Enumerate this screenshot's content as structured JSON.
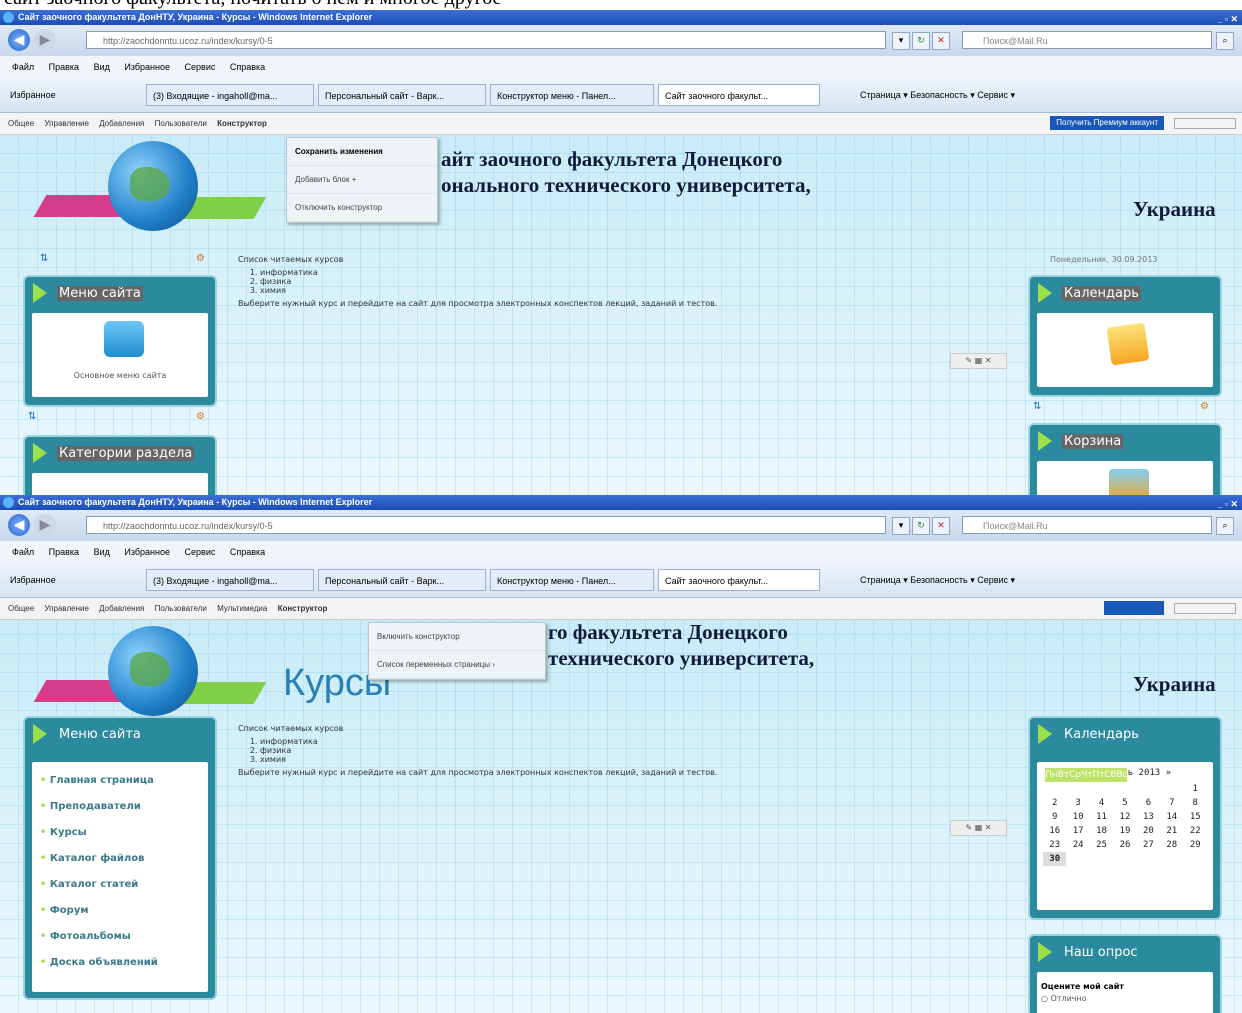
{
  "shot1": {
    "window_title": "Сайт заочного факультета ДонНТУ, Украина - Курсы - Windows Internet Explorer",
    "url": "http://zaochdonntu.ucoz.ru/index/kursy/0-5",
    "search_placeholder": "Поиск@Mail.Ru",
    "menu": [
      "Файл",
      "Правка",
      "Вид",
      "Избранное",
      "Сервис",
      "Справка"
    ],
    "favorites": "Избранное",
    "tabs": [
      "(3) Входящие - ingaholl@ma...",
      "Персональный сайт - Варк...",
      "Конструктор меню - Панел...",
      "Сайт заочного факульт..."
    ],
    "ie_right": "Страница ▾   Безопасность ▾   Сервис ▾",
    "ucoz_menu": [
      "Общее",
      "Управление",
      "Добавления",
      "Пользователи"
    ],
    "ucoz_active": "Конструктор",
    "premium": "Получить Премиум аккаунт",
    "dropdown": [
      "Сохранить изменения",
      "Добавить блок +",
      "Отключить конструктор"
    ],
    "site_title_1": "айт заочного факультета Донецкого",
    "site_title_2": "онального технического университета,",
    "country": "Украина",
    "date_fragment": "Понедельник, 30.09.2013",
    "blocks": {
      "menu": {
        "title": "Меню сайта",
        "caption": "Основное меню сайта"
      },
      "categories": {
        "title": "Категории раздела"
      },
      "calendar": {
        "title": "Календарь"
      },
      "cart": {
        "title": "Корзина"
      }
    },
    "content": {
      "heading": "Список читаемых курсов",
      "items": [
        "информатика",
        "физика",
        "химия"
      ],
      "text": "Выберите нужный курс и перейдите на сайт для просмотра электронных конспектов лекций, заданий и тестов."
    }
  },
  "shot2": {
    "window_title": "Сайт заочного факультета ДонНТУ, Украина - Курсы - Windows Internet Explorer",
    "url": "http://zaochdonntu.ucoz.ru/index/kursy/0-5",
    "search_placeholder": "Поиск@Mail.Ru",
    "menu": [
      "Файл",
      "Правка",
      "Вид",
      "Избранное",
      "Сервис",
      "Справка"
    ],
    "favorites": "Избранное",
    "tabs": [
      "(3) Входящие - ingaholl@ma...",
      "Персональный сайт - Варк...",
      "Конструктор меню - Панел...",
      "Сайт заочного факульт..."
    ],
    "ie_right": "Страница ▾   Безопасность ▾   Сервис ▾",
    "ucoz_menu": [
      "Общее",
      "Управление",
      "Добавления",
      "Пользователи",
      "Мультимедиа"
    ],
    "ucoz_active": "Конструктор",
    "dropdown": [
      "Включить конструктор",
      "Список переменных страницы ›"
    ],
    "site_title_1": "го факультета Донецкого",
    "site_title_2": "технического университета,",
    "country": "Украина",
    "page_heading": "Курсы",
    "blocks": {
      "menu": {
        "title": "Меню сайта",
        "items": [
          "Главная страница",
          "Преподаватели",
          "Курсы",
          "Каталог файлов",
          "Каталог статей",
          "Форум",
          "Фотоальбомы",
          "Доска объявлений"
        ]
      },
      "calendar": {
        "title": "Календарь",
        "month": "«  Сентябрь 2013  »",
        "days": [
          "Пн",
          "Вт",
          "Ср",
          "Чт",
          "Пт",
          "Сб",
          "Вс"
        ],
        "weeks": [
          [
            "",
            "",
            "",
            "",
            "",
            "",
            "1"
          ],
          [
            "2",
            "3",
            "4",
            "5",
            "6",
            "7",
            "8"
          ],
          [
            "9",
            "10",
            "11",
            "12",
            "13",
            "14",
            "15"
          ],
          [
            "16",
            "17",
            "18",
            "19",
            "20",
            "21",
            "22"
          ],
          [
            "23",
            "24",
            "25",
            "26",
            "27",
            "28",
            "29"
          ],
          [
            "30",
            "",
            "",
            "",
            "",
            "",
            ""
          ]
        ]
      },
      "poll": {
        "title": "Наш опрос",
        "question": "Оцените мой сайт",
        "option": "Отлично"
      }
    },
    "content": {
      "heading": "Список читаемых курсов",
      "items": [
        "информатика",
        "физика",
        "химия"
      ],
      "text": "Выберите нужный курс и перейдите на сайт для просмотра электронных конспектов лекций, заданий и тестов."
    }
  },
  "caption_fragment": "сайт заочного факультета, почитать о нем и многое другое"
}
